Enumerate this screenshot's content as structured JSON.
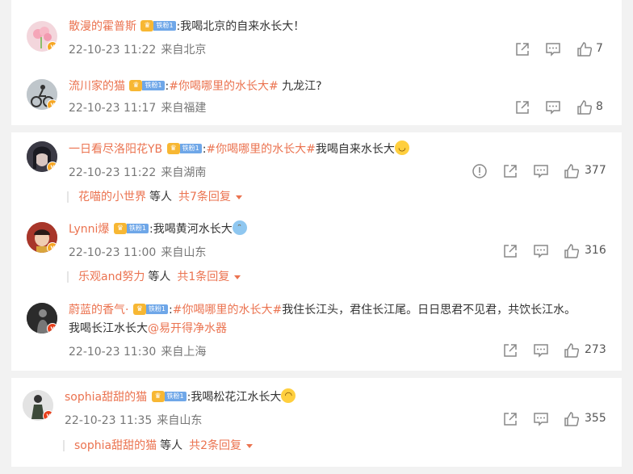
{
  "icons": {
    "share": "share-icon",
    "comment": "comment-icon",
    "like": "like-icon",
    "report": "report-icon"
  },
  "colors": {
    "username": "#eb7350",
    "background": "#f2f2f2",
    "card": "#ffffff",
    "fan_badge": "#6fa7e8"
  },
  "fan_badge_label": "铁粉1",
  "cards": [
    {
      "comments": [
        {
          "user": "散漫的霍普斯",
          "sep": ":",
          "tag": "",
          "text": "我喝北京的自来水长大！",
          "text2": "",
          "date": "22-10-23 11:22",
          "loc": "来自北京",
          "likes": "7"
        },
        {
          "user": "流川家的猫",
          "sep": ":",
          "tag": "#你喝哪里的水长大#",
          "text": " 九龙江?",
          "text2": "",
          "date": "22-10-23 11:17",
          "loc": "来自福建",
          "likes": "8"
        }
      ]
    },
    {
      "comments": [
        {
          "user": "一日看尽洛阳花YB",
          "sep": ":",
          "tag": "#你喝哪里的水长大#",
          "text": "我喝自来水长大",
          "text2": "",
          "date": "22-10-23 11:22",
          "loc": "来自湖南",
          "likes": "377",
          "reply_user": "花喵的小世界",
          "reply_wait": "等人",
          "reply_total": "共7条回复"
        },
        {
          "user": "Lynni爆",
          "sep": ":",
          "tag": "",
          "text": "我喝黄河水长大",
          "text2": "",
          "date": "22-10-23 11:00",
          "loc": "来自山东",
          "likes": "316",
          "reply_user": "乐观and努力",
          "reply_wait": "等人",
          "reply_total": "共1条回复"
        },
        {
          "user": "蔚蓝的香气·",
          "sep": ":",
          "tag": "#你喝哪里的水长大#",
          "text": "我住长江头，君住长江尾。日日思君不见君，共饮长江水。",
          "text2": "我喝长江水长大",
          "mention": "@易开得净水器",
          "date": "22-10-23 11:30",
          "loc": "来自上海",
          "likes": "273"
        }
      ]
    },
    {
      "comments": [
        {
          "user": "sophia甜甜的猫",
          "sep": ":",
          "tag": "",
          "text": "我喝松花江水长大",
          "text2": "",
          "date": "22-10-23 11:35",
          "loc": "来自山东",
          "likes": "355",
          "reply_user": "sophia甜甜的猫",
          "reply_wait": "等人",
          "reply_total": "共2条回复"
        }
      ]
    }
  ]
}
